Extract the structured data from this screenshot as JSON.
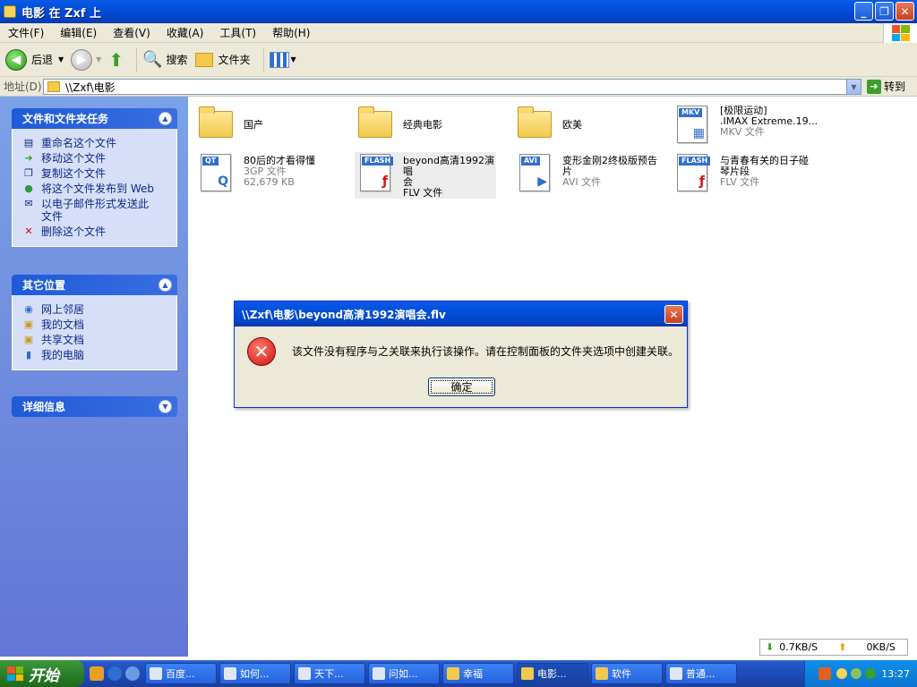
{
  "window": {
    "title": "电影 在 Zxf 上"
  },
  "menu": [
    "文件(F)",
    "编辑(E)",
    "查看(V)",
    "收藏(A)",
    "工具(T)",
    "帮助(H)"
  ],
  "toolbar": {
    "back": "后退",
    "search": "搜索",
    "folders": "文件夹"
  },
  "address": {
    "label": "地址(D)",
    "value": "\\\\Zxf\\电影",
    "go": "转到"
  },
  "panels": {
    "tasks": {
      "title": "文件和文件夹任务",
      "items": [
        "重命名这个文件",
        "移动这个文件",
        "复制这个文件",
        "将这个文件发布到 Web",
        "以电子邮件形式发送此文件",
        "删除这个文件"
      ]
    },
    "places": {
      "title": "其它位置",
      "items": [
        "网上邻居",
        "我的文档",
        "共享文档",
        "我的电脑"
      ]
    },
    "details": {
      "title": "详细信息"
    }
  },
  "files": [
    {
      "name": "国产",
      "type": "folder"
    },
    {
      "name": "经典电影",
      "type": "folder"
    },
    {
      "name": "欧美",
      "type": "folder"
    },
    {
      "name": "[极限运动]",
      "name2": ".IMAX Extreme.19...",
      "sub": "MKV 文件",
      "type": "mkv",
      "badge": "MKV"
    },
    {
      "name": "80后的才看得懂",
      "sub": "3GP 文件",
      "sub2": "62,679 KB",
      "type": "qt",
      "badge": "QT"
    },
    {
      "name": "beyond高清1992演唱",
      "name2": "会",
      "sub": "FLV 文件",
      "type": "flash",
      "badge": "FLASH"
    },
    {
      "name": "变形金刚2终极版预告",
      "name2": "片",
      "sub": "AVI 文件",
      "type": "avi",
      "badge": "AVI"
    },
    {
      "name": "与青春有关的日子碰",
      "name2": "琴片段",
      "sub": "FLV 文件",
      "type": "flash",
      "badge": "FLASH"
    }
  ],
  "dialog": {
    "title": "\\\\Zxf\\电影\\beyond高清1992演唱会.flv",
    "message": "该文件没有程序与之关联来执行该操作。请在控制面板的文件夹选项中创建关联。",
    "ok": "确定"
  },
  "netstatus": {
    "down": "0.7KB/S",
    "up": "0KB/S"
  },
  "taskbar": {
    "start": "开始",
    "tasks": [
      "百度...",
      "如何...",
      "天下...",
      "问如...",
      "幸福",
      "电影...",
      "软件",
      "普通..."
    ],
    "clock": "13:27"
  }
}
